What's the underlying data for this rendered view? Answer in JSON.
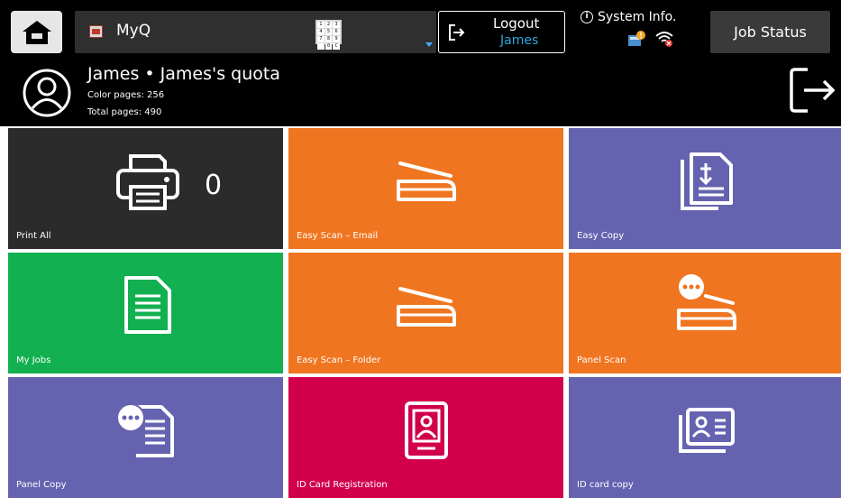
{
  "header": {
    "app_name": "MyQ",
    "keypad_keys": [
      "1",
      "2",
      "3",
      "4",
      "5",
      "6",
      "7",
      "8",
      "9",
      "",
      "0",
      "C"
    ],
    "logout": {
      "label": "Logout",
      "user": "James"
    },
    "system_info": {
      "label": "System Info.",
      "icon": "info-icon",
      "device_icon": "device-warning-icon",
      "network_icon": "wifi-off-icon"
    },
    "job_status_label": "Job Status"
  },
  "user": {
    "title": "James • James's quota",
    "color_pages": "Color pages: 256",
    "total_pages": "Total pages: 490"
  },
  "tiles": [
    {
      "label": "Print All",
      "count": "0",
      "icon": "printer-icon",
      "color": "#2b2b2b"
    },
    {
      "label": "Easy Scan – Email",
      "icon": "scanner-icon",
      "color": "#f07520"
    },
    {
      "label": "Easy Copy",
      "icon": "copy-documents-icon",
      "color": "#6563b0"
    },
    {
      "label": "My Jobs",
      "icon": "document-icon",
      "color": "#12b050"
    },
    {
      "label": "Easy Scan – Folder",
      "icon": "scanner-icon",
      "color": "#f07520"
    },
    {
      "label": "Panel Scan",
      "icon": "scanner-more-icon",
      "color": "#f07520"
    },
    {
      "label": "Panel Copy",
      "icon": "document-more-icon",
      "color": "#6563b0"
    },
    {
      "label": "ID Card Registration",
      "icon": "id-badge-icon",
      "color": "#d2004b"
    },
    {
      "label": "ID card copy",
      "icon": "id-card-icon",
      "color": "#6563b0"
    }
  ]
}
